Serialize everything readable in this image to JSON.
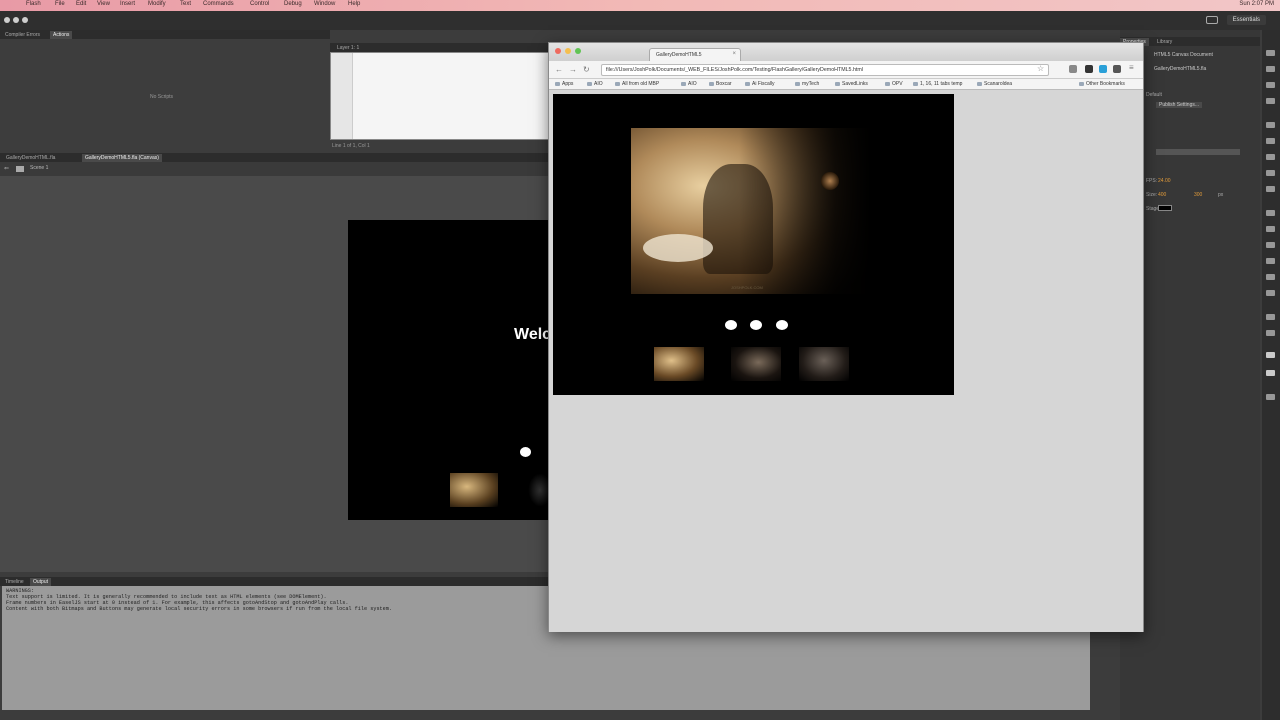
{
  "menubar": {
    "apple": "",
    "items": [
      "Flash",
      "File",
      "Edit",
      "View",
      "Insert",
      "Modify",
      "Text",
      "Commands",
      "Control",
      "Debug",
      "Window",
      "Help"
    ],
    "clock": "Sun 2:07 PM"
  },
  "appbar": {
    "workspace": "Essentials"
  },
  "top_left_panel": {
    "tabs": [
      "Compiler Errors",
      "Actions"
    ],
    "placeholder": "No Scripts"
  },
  "code_panel": {
    "title": "Layer 1: 1",
    "status": "Line 1 of 1, Col 1"
  },
  "document_tabs": [
    "GalleryDemoHTML.fla",
    "GalleryDemoHTML5.fla (Canvas)"
  ],
  "scene": {
    "label": "Scene 1"
  },
  "stage": {
    "welcome_text": "Welc"
  },
  "output_panel": {
    "tabs": [
      "Timeline",
      "Output"
    ],
    "lines": [
      "WARNINGS:",
      "Text support is limited. It is generally recommended to include text as HTML elements (see DOMElement).",
      "Frame numbers in EaselJS start at 0 instead of 1. For example, this affects gotoAndStop and gotoAndPlay calls.",
      "Content with both Bitmaps and Buttons may generate local security errors in some browsers if run from the local file system."
    ]
  },
  "properties_panel": {
    "tabs": [
      "Properties",
      "Library"
    ],
    "doc_type": "HTML5 Canvas Document",
    "doc_name": "GalleryDemoHTML5.fla",
    "profile": "Default",
    "publish": "Publish Settings...",
    "fps_label": "FPS:",
    "fps": "24.00",
    "size_label": "Size:",
    "width": "400",
    "height": "300",
    "units": "px",
    "stage_label": "Stage:"
  },
  "browser": {
    "tab_title": "GalleryDemoHTML5",
    "url": "file:///Users/JoshPolk/Documents/_WEB_FILES/JoshPolk.com/Testing/FlashGallery/GalleryDemoHTML5.html",
    "bookmarks": [
      "Apps",
      "AIO",
      "All from old MBP",
      "AIO",
      "Boxcar",
      "Ai Fiscally",
      "myTech",
      "SavedLinks",
      "OPV",
      "1, 16, 11 tabs temp",
      "Scanaroldea"
    ],
    "other_bookmarks": "Other Bookmarks"
  },
  "gallery": {
    "dots": 3,
    "thumbnails": 3,
    "watermark": "JOSHPOLK.COM"
  },
  "colors": {
    "accent": "#e6a4ad",
    "fps_value": "#e09a3a",
    "canvas_bg": "#000000"
  }
}
